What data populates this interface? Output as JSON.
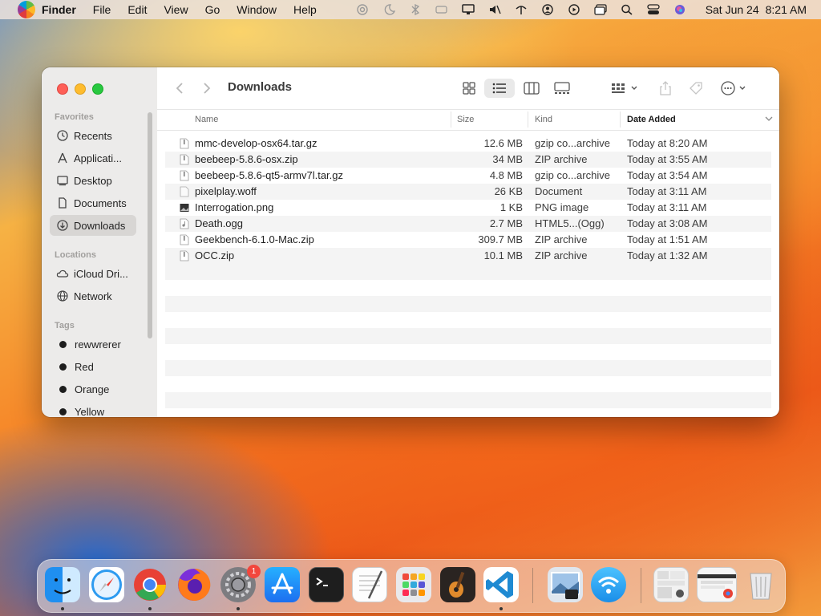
{
  "menubar": {
    "app_name": "Finder",
    "items": [
      "File",
      "Edit",
      "View",
      "Go",
      "Window",
      "Help"
    ],
    "date": "Sat Jun 24",
    "time": "8:21 AM"
  },
  "window": {
    "title": "Downloads",
    "sidebar": {
      "favorites_label": "Favorites",
      "favorites": [
        {
          "label": "Recents",
          "icon": "clock-icon"
        },
        {
          "label": "Applicati...",
          "icon": "applications-icon"
        },
        {
          "label": "Desktop",
          "icon": "desktop-icon"
        },
        {
          "label": "Documents",
          "icon": "document-icon"
        },
        {
          "label": "Downloads",
          "icon": "download-icon",
          "selected": true
        }
      ],
      "locations_label": "Locations",
      "locations": [
        {
          "label": "iCloud Dri...",
          "icon": "cloud-icon"
        },
        {
          "label": "Network",
          "icon": "globe-icon"
        }
      ],
      "tags_label": "Tags",
      "tags": [
        "rewwrerer",
        "Red",
        "Orange",
        "Yellow"
      ]
    },
    "columns": {
      "name": "Name",
      "size": "Size",
      "kind": "Kind",
      "date_added": "Date Added"
    },
    "files": [
      {
        "name": "mmc-develop-osx64.tar.gz",
        "size": "12.6 MB",
        "kind": "gzip co...archive",
        "date": "Today at 8:20 AM",
        "icon": "archive-file-icon"
      },
      {
        "name": "beebeep-5.8.6-osx.zip",
        "size": "34 MB",
        "kind": "ZIP archive",
        "date": "Today at 3:55 AM",
        "icon": "zip-file-icon"
      },
      {
        "name": "beebeep-5.8.6-qt5-armv7l.tar.gz",
        "size": "4.8 MB",
        "kind": "gzip co...archive",
        "date": "Today at 3:54 AM",
        "icon": "archive-file-icon"
      },
      {
        "name": "pixelplay.woff",
        "size": "26 KB",
        "kind": "Document",
        "date": "Today at 3:11 AM",
        "icon": "blank-file-icon"
      },
      {
        "name": "Interrogation.png",
        "size": "1 KB",
        "kind": "PNG image",
        "date": "Today at 3:11 AM",
        "icon": "image-file-icon"
      },
      {
        "name": "Death.ogg",
        "size": "2.7 MB",
        "kind": "HTML5...(Ogg)",
        "date": "Today at 3:08 AM",
        "icon": "audio-file-icon"
      },
      {
        "name": "Geekbench-6.1.0-Mac.zip",
        "size": "309.7 MB",
        "kind": "ZIP archive",
        "date": "Today at 1:51 AM",
        "icon": "zip-file-icon"
      },
      {
        "name": "OCC.zip",
        "size": "10.1 MB",
        "kind": "ZIP archive",
        "date": "Today at 1:32 AM",
        "icon": "zip-file-icon"
      }
    ]
  },
  "dock": {
    "apps": [
      {
        "name": "Finder",
        "icon": "finder-icon"
      },
      {
        "name": "Safari",
        "icon": "safari-icon"
      },
      {
        "name": "Chrome",
        "icon": "chrome-icon"
      },
      {
        "name": "Firefox",
        "icon": "firefox-icon"
      },
      {
        "name": "System Settings",
        "icon": "settings-icon",
        "badge": "1"
      },
      {
        "name": "App Store",
        "icon": "app-store-icon"
      },
      {
        "name": "Terminal",
        "icon": "terminal-icon"
      },
      {
        "name": "TextEdit",
        "icon": "textedit-icon"
      },
      {
        "name": "Launchpad",
        "icon": "launchpad-icon"
      },
      {
        "name": "GarageBand",
        "icon": "garageband-icon"
      },
      {
        "name": "VS Code",
        "icon": "vscode-icon"
      },
      {
        "name": "Preview",
        "icon": "preview-icon"
      },
      {
        "name": "Wireless Diagnostics",
        "icon": "wifi-icon"
      },
      {
        "name": "Downloads Stack",
        "icon": "stack-icon"
      },
      {
        "name": "Recent Window",
        "icon": "window-thumbnail-icon"
      },
      {
        "name": "Trash",
        "icon": "trash-icon"
      }
    ]
  },
  "colors": {
    "accent": "#007aff",
    "close": "#fe5f57",
    "minimize": "#febc2e",
    "maximize": "#28c840",
    "badge": "#f2463c"
  }
}
